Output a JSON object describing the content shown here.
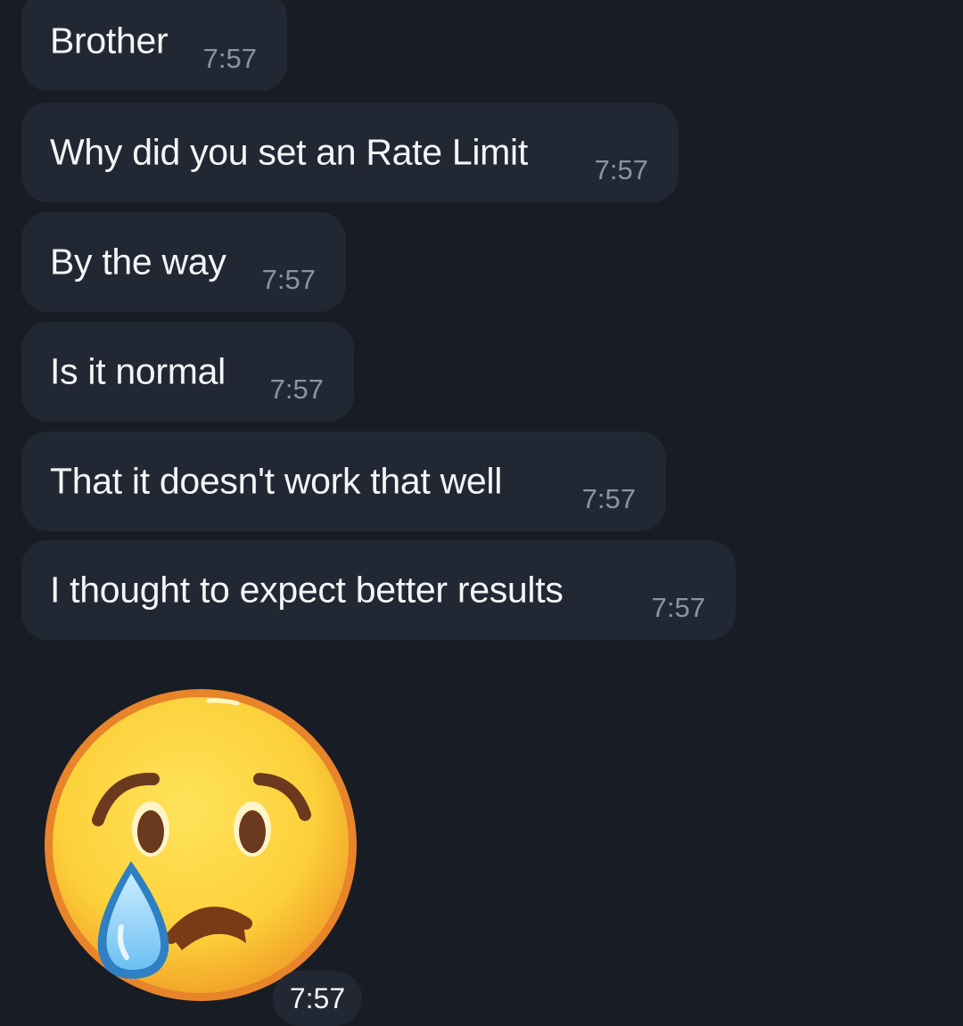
{
  "messages": [
    {
      "text": "Brother",
      "time": "7:57"
    },
    {
      "text": "Why did you set an Rate Limit",
      "time": "7:57"
    },
    {
      "text": "By the way",
      "time": "7:57"
    },
    {
      "text": "Is it normal",
      "time": "7:57"
    },
    {
      "text": "That it doesn't work that well",
      "time": "7:57"
    },
    {
      "text": "I thought to expect better results",
      "time": "7:57"
    }
  ],
  "sticker": {
    "icon": "crying-face-icon",
    "time": "7:57"
  },
  "colors": {
    "background": "#181c24",
    "bubble": "#222833",
    "text": "#f4f5f7",
    "timestamp": "#8a93a3"
  }
}
